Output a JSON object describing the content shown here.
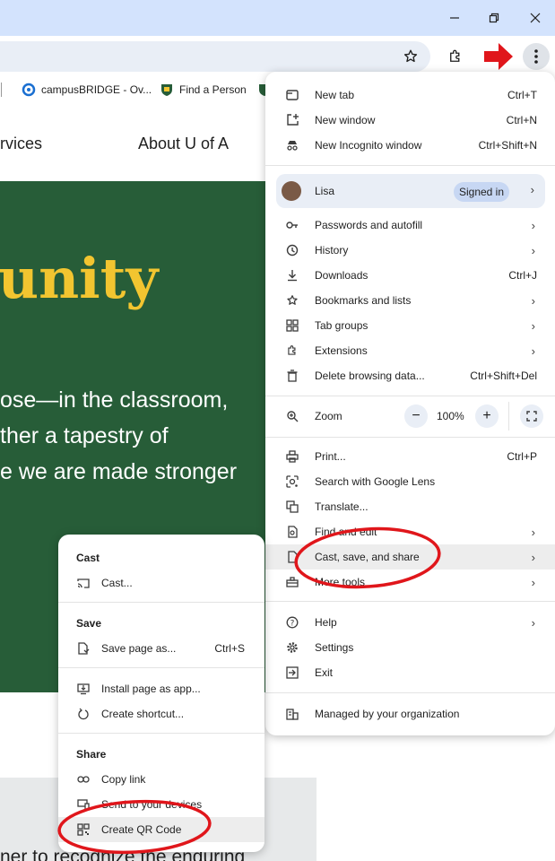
{
  "window": {
    "minimize_icon": "minimize-icon",
    "restore_icon": "restore-icon",
    "close_icon": "close-icon"
  },
  "bookmarks": [
    {
      "label": "campusBRIDGE - Ov..."
    },
    {
      "label": "Find a Person"
    }
  ],
  "site": {
    "nav": [
      "rvices",
      "About U of A"
    ],
    "hero_title": "unity",
    "hero_lines": [
      "ose—in the classroom,",
      "ther a tapestry of",
      "e we are made stronger"
    ],
    "bottom_text": "ner to recognize the enduring"
  },
  "menu": {
    "group1": [
      {
        "label": "New tab",
        "shortcut": "Ctrl+T"
      },
      {
        "label": "New window",
        "shortcut": "Ctrl+N"
      },
      {
        "label": "New Incognito window",
        "shortcut": "Ctrl+Shift+N"
      }
    ],
    "profile": {
      "name": "Lisa",
      "status": "Signed in"
    },
    "group2": [
      {
        "label": "Passwords and autofill"
      },
      {
        "label": "History"
      },
      {
        "label": "Downloads",
        "shortcut": "Ctrl+J"
      },
      {
        "label": "Bookmarks and lists"
      },
      {
        "label": "Tab groups"
      },
      {
        "label": "Extensions"
      },
      {
        "label": "Delete browsing data...",
        "shortcut": "Ctrl+Shift+Del"
      }
    ],
    "zoom": {
      "label": "Zoom",
      "value": "100%",
      "minus": "−",
      "plus": "+"
    },
    "group3": [
      {
        "label": "Print...",
        "shortcut": "Ctrl+P"
      },
      {
        "label": "Search with Google Lens"
      },
      {
        "label": "Translate..."
      },
      {
        "label": "Find and edit"
      },
      {
        "label": "Cast, save, and share"
      },
      {
        "label": "More tools"
      }
    ],
    "group4": [
      {
        "label": "Help"
      },
      {
        "label": "Settings"
      },
      {
        "label": "Exit"
      }
    ],
    "managed": "Managed by your organization"
  },
  "submenu": {
    "cast_header": "Cast",
    "cast_item": "Cast...",
    "save_header": "Save",
    "save_item": {
      "label": "Save page as...",
      "shortcut": "Ctrl+S"
    },
    "install_item": "Install page as app...",
    "shortcut_item": "Create shortcut...",
    "share_header": "Share",
    "copy_link": "Copy link",
    "send_devices": "Send to your devices",
    "qr_code": "Create QR Code"
  },
  "colors": {
    "hero_bg": "#275d38",
    "hero_title": "#f2c530",
    "annotation_red": "#e0161b",
    "titlebar": "#d3e3fd"
  }
}
